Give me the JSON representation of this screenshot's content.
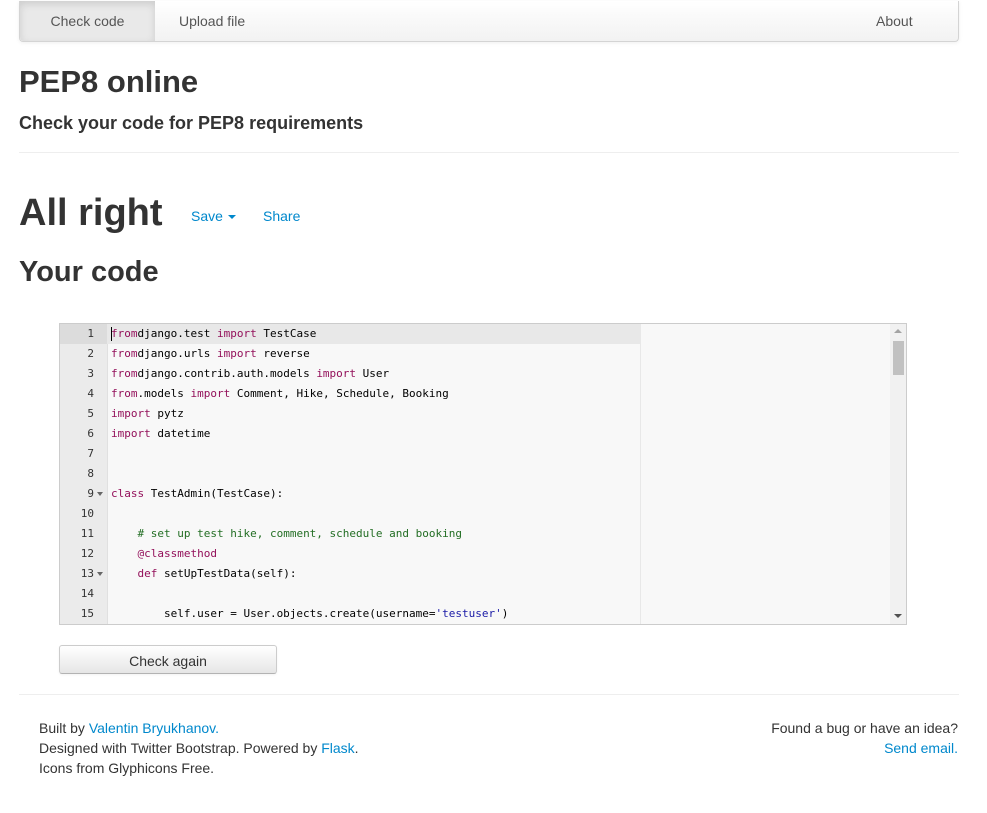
{
  "navbar": {
    "items": [
      {
        "label": "Check code"
      },
      {
        "label": "Upload file"
      },
      {
        "label": "About"
      }
    ]
  },
  "header": {
    "title": "PEP8 online",
    "subtitle": "Check your code for PEP8 requirements"
  },
  "result": {
    "title": "All right",
    "save_label": "Save",
    "share_label": "Share"
  },
  "code_section": {
    "title": "Your code",
    "lines": [
      {
        "n": "1",
        "parts": [
          [
            "kw",
            "from"
          ],
          [
            "",
            "django.test "
          ],
          [
            "kw",
            "import"
          ],
          [
            "",
            " TestCase"
          ]
        ]
      },
      {
        "n": "2",
        "parts": [
          [
            "kw",
            "from"
          ],
          [
            "",
            "django.urls "
          ],
          [
            "kw",
            "import"
          ],
          [
            "",
            " reverse"
          ]
        ]
      },
      {
        "n": "3",
        "parts": [
          [
            "kw",
            "from"
          ],
          [
            "",
            "django.contrib.auth.models "
          ],
          [
            "kw",
            "import"
          ],
          [
            "",
            " User"
          ]
        ]
      },
      {
        "n": "4",
        "parts": [
          [
            "kw",
            "from"
          ],
          [
            "",
            ".models "
          ],
          [
            "kw",
            "import"
          ],
          [
            "",
            " Comment, Hike, Schedule, Booking"
          ]
        ]
      },
      {
        "n": "5",
        "parts": [
          [
            "kw",
            "import"
          ],
          [
            "",
            " pytz"
          ]
        ]
      },
      {
        "n": "6",
        "parts": [
          [
            "kw",
            "import"
          ],
          [
            "",
            " datetime"
          ]
        ]
      },
      {
        "n": "7",
        "parts": []
      },
      {
        "n": "8",
        "parts": []
      },
      {
        "n": "9",
        "fold": true,
        "parts": [
          [
            "kw",
            "class"
          ],
          [
            "",
            " TestAdmin(TestCase):"
          ]
        ]
      },
      {
        "n": "10",
        "parts": []
      },
      {
        "n": "11",
        "parts": [
          [
            "",
            "    "
          ],
          [
            "cm",
            "# set up test hike, comment, schedule and booking"
          ]
        ]
      },
      {
        "n": "12",
        "parts": [
          [
            "",
            "    "
          ],
          [
            "kw",
            "@classmethod"
          ]
        ]
      },
      {
        "n": "13",
        "fold": true,
        "parts": [
          [
            "",
            "    "
          ],
          [
            "kw",
            "def"
          ],
          [
            "",
            " setUpTestData(self):"
          ]
        ]
      },
      {
        "n": "14",
        "parts": []
      },
      {
        "n": "15",
        "parts": [
          [
            "",
            "        self.user = User.objects.create(username="
          ],
          [
            "st",
            "'testuser'"
          ],
          [
            "",
            ")"
          ]
        ]
      }
    ]
  },
  "check_again_label": "Check again",
  "footer": {
    "built_by_prefix": "Built by ",
    "author": "Valentin Bryukhanov.",
    "designed_prefix": "Designed with Twitter Bootstrap. Powered by ",
    "flask": "Flask",
    "designed_suffix": ".",
    "icons": "Icons from Glyphicons Free.",
    "bug_text": "Found a bug or have an idea?",
    "send_email": "Send email."
  }
}
